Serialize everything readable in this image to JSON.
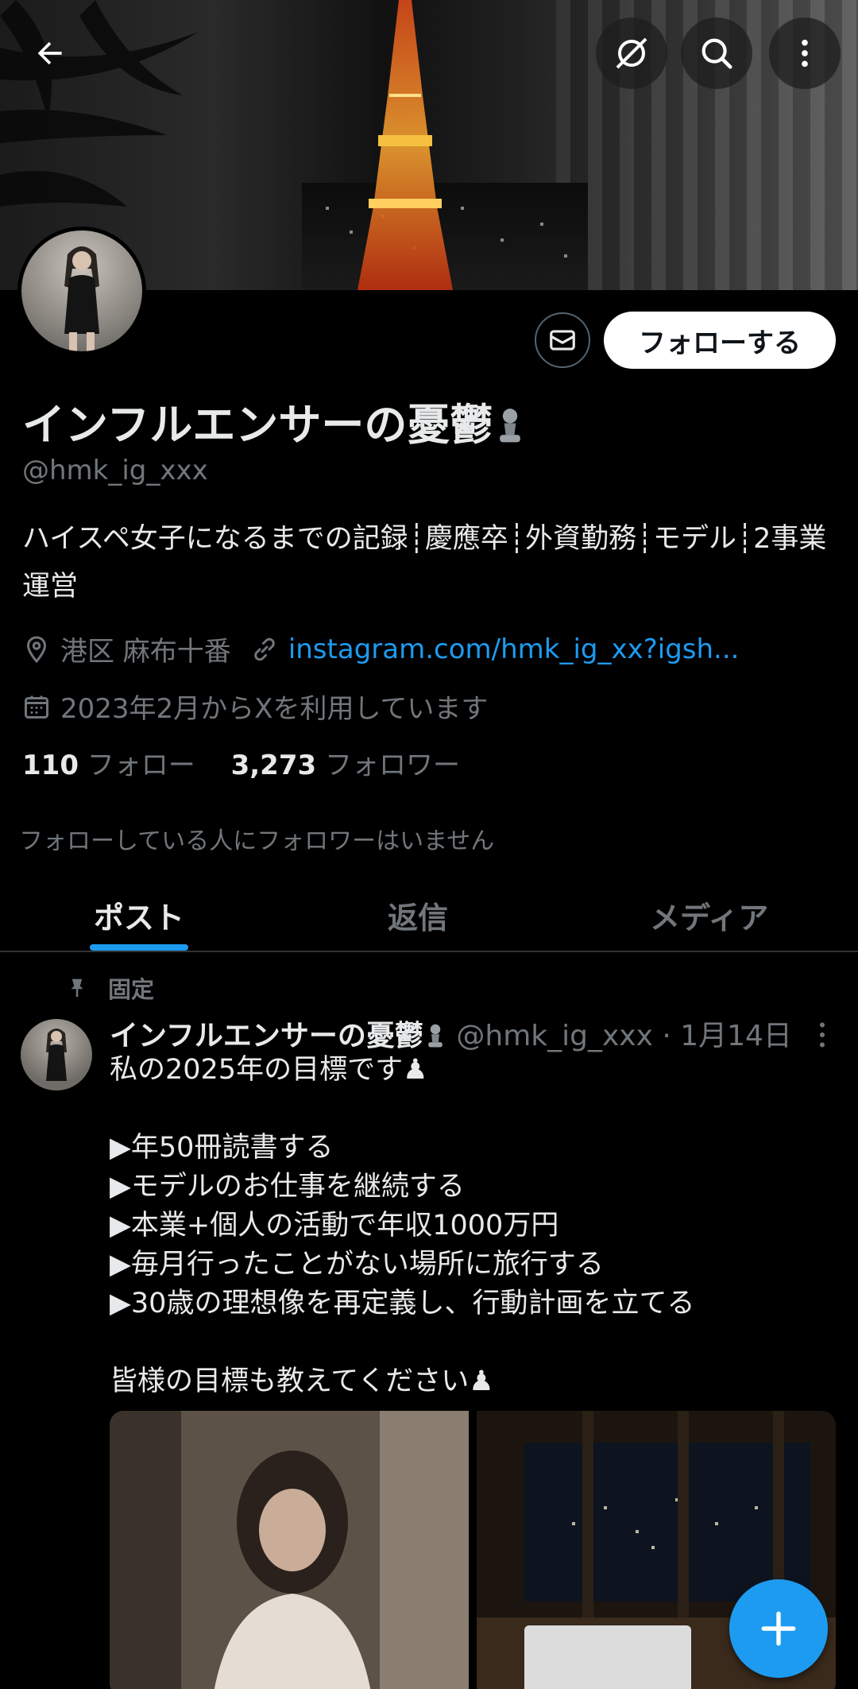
{
  "profile": {
    "display_name": "インフルエンサーの憂鬱",
    "handle": "@hmk_ig_xxx",
    "bio": "ハイスペ女子になるまでの記録┊慶應卒┊外資勤務┊モデル┊2事業運営",
    "location": "港区 麻布十番",
    "link": "instagram.com/hmk_ig_xx?igsh...",
    "joined": "2023年2月からXを利用しています",
    "following_count": "110",
    "following_label": "フォロー",
    "followers_count": "3,273",
    "followers_label": "フォロワー",
    "followers_notice": "フォローしている人にフォロワーはいません"
  },
  "actions": {
    "follow_label": "フォローする"
  },
  "tabs": [
    {
      "label": "ポスト",
      "active": true
    },
    {
      "label": "返信",
      "active": false
    },
    {
      "label": "メディア",
      "active": false
    }
  ],
  "post": {
    "pinned_label": "固定",
    "author": "インフルエンサーの憂鬱",
    "meta": "@hmk_ig_xxx · 1月14日",
    "text": "私の2025年の目標です♟\n\n▶年50冊読書する\n▶モデルのお仕事を継続する\n▶本業+個人の活動で年収1000万円\n▶毎月行ったことがない場所に旅行する\n▶30歳の理想像を再定義し、行動計画を立てる\n\n皆様の目標も教えてください♟"
  },
  "colors": {
    "accent": "#1d9bf0",
    "background": "#000000",
    "text_primary": "#e7e9ea",
    "text_secondary": "#71767b"
  }
}
